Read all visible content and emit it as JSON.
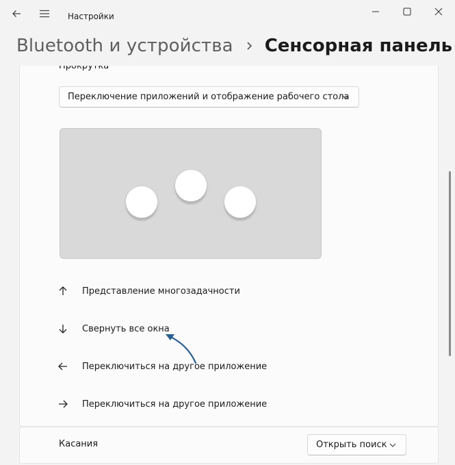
{
  "window": {
    "title": "Настройки",
    "icons": {
      "back": "back-arrow-icon",
      "menu": "hamburger-menu-icon",
      "minimize": "minimize-icon",
      "maximize": "maximize-icon",
      "close": "close-icon"
    }
  },
  "breadcrumb": {
    "parent": "Bluetooth и устройства",
    "current": "Сенсорная панель"
  },
  "scroll": {
    "section_label": "Прокрутка",
    "dropdown_value": "Переключение приложений и отображение рабочего стола"
  },
  "gestures": [
    {
      "icon": "arrow-up-icon",
      "label": "Представление многозадачности"
    },
    {
      "icon": "arrow-down-icon",
      "label": "Свернуть все окна"
    },
    {
      "icon": "arrow-left-icon",
      "label": "Переключиться на другое приложение"
    },
    {
      "icon": "arrow-right-icon",
      "label": "Переключиться на другое приложение"
    }
  ],
  "taps": {
    "label": "Касания",
    "dropdown_value": "Открыть поиск"
  },
  "colors": {
    "background": "#f3f3f3",
    "card": "#fbfbfb",
    "touchpad": "#d9d9d9",
    "annotation_arrow": "#2a5f8f"
  }
}
